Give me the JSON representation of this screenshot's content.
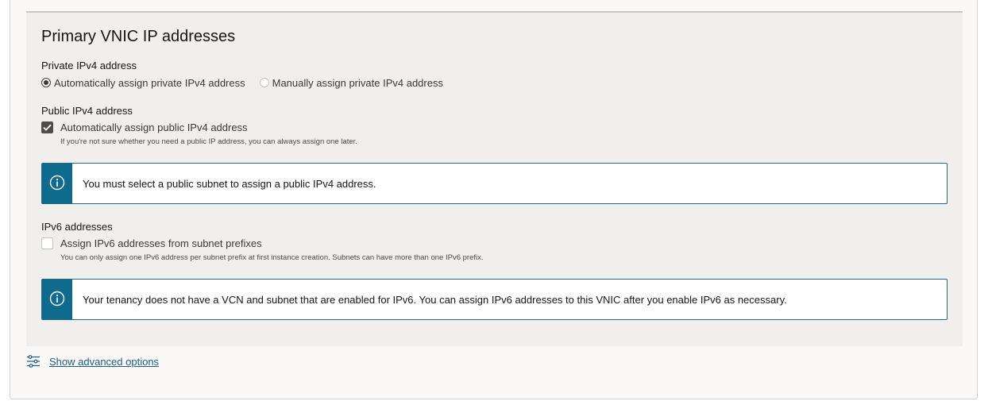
{
  "section": {
    "title": "Primary VNIC IP addresses"
  },
  "private_ipv4": {
    "label": "Private IPv4 address",
    "options": [
      {
        "label": "Automatically assign private IPv4 address",
        "selected": true
      },
      {
        "label": "Manually assign private IPv4 address",
        "selected": false
      }
    ]
  },
  "public_ipv4": {
    "label": "Public IPv4 address",
    "checkbox_label": "Automatically assign public IPv4 address",
    "checked": true,
    "help": "If you're not sure whether you need a public IP address, you can always assign one later.",
    "info": "You must select a public subnet to assign a public IPv4 address."
  },
  "ipv6": {
    "label": "IPv6 addresses",
    "checkbox_label": "Assign IPv6 addresses from subnet prefixes",
    "checked": false,
    "help": "You can only assign one IPv6 address per subnet prefix at first instance creation. Subnets can have more than one IPv6 prefix.",
    "info": "Your tenancy does not have a VCN and subnet that are enabled for IPv6. You can assign IPv6 addresses to this VNIC after you enable IPv6 as necessary."
  },
  "advanced": {
    "link": "Show advanced options",
    "icon": "sliders-icon"
  },
  "colors": {
    "info_accent": "#0e6b8d",
    "link": "#1f5a89",
    "panel_bg": "#f1efed"
  }
}
